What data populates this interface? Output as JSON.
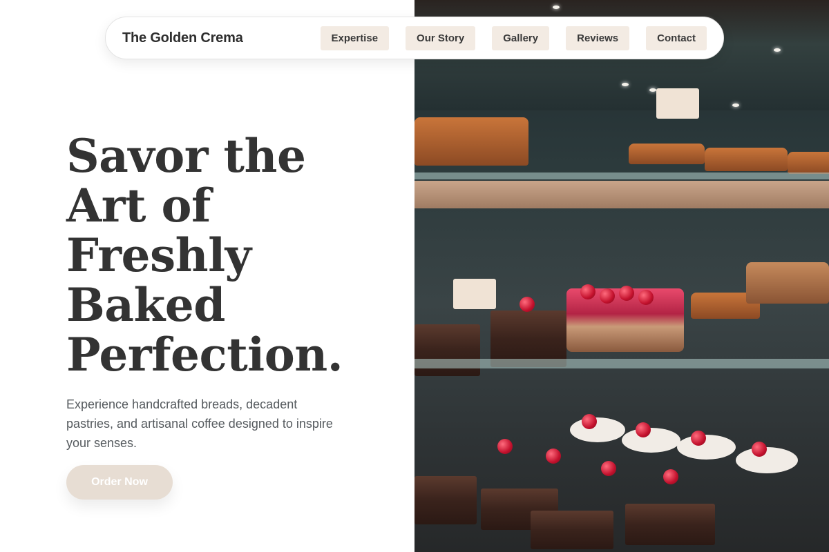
{
  "brand": {
    "name": "The Golden Crema"
  },
  "nav": {
    "items": [
      {
        "label": "Expertise"
      },
      {
        "label": "Our Story"
      },
      {
        "label": "Gallery"
      },
      {
        "label": "Reviews"
      },
      {
        "label": "Contact"
      }
    ]
  },
  "hero": {
    "headline_lines": [
      "Savor the",
      "Art of",
      "Freshly",
      "Baked",
      "Perfection."
    ],
    "subtext": "Experience handcrafted breads, decadent pastries, and artisanal coffee designed to inspire your senses.",
    "cta_label": "Order Now"
  },
  "colors": {
    "text_dark": "#333333",
    "accent_beige": "#f3ebe3",
    "cta_bg": "#e7ddd3"
  }
}
